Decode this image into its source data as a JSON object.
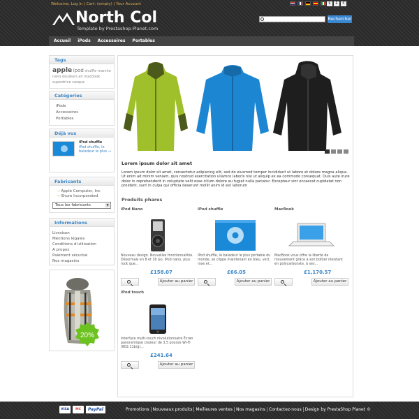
{
  "header": {
    "toplinks": {
      "welcome": "Welcome, ",
      "login": "Log in",
      "sep1": " | ",
      "cart": "Cart: (empty)",
      "sep2": " | ",
      "account": "Your Account"
    },
    "currencies": [
      "$",
      "£",
      "€"
    ],
    "logo_title": "North Col",
    "logo_sub": "Template by Prestashop-Planet.com",
    "search_button": "Rechercher"
  },
  "nav": [
    "Accueil",
    "iPods",
    "Accessoires",
    "Portables"
  ],
  "sidebar": {
    "tags_title": "Tags",
    "tags": {
      "big": "apple",
      "mid": "ipod",
      "rest": "shuffle  marche  nano  douleurs  air  macbook  superdrive  casque"
    },
    "categories_title": "Catégories",
    "categories": [
      "iPods",
      "Accessoires",
      "Portables"
    ],
    "viewed_title": "Déjà vus",
    "viewed_name": "iPod shuffle",
    "viewed_desc": "iPod shuffle, le baladeur le plus →",
    "manufacturers_title": "Fabricants",
    "manufacturers": [
      "Apple Computer, Inc",
      "Shure Incorporated"
    ],
    "manufacturers_select": "Tous les fabricants",
    "info_title": "Informations",
    "info": [
      "Livraison",
      "Mentions légales",
      "Conditions d'utilisation",
      "A propos",
      "Paiement sécurisé",
      "Nos magasins"
    ],
    "promo_badge": "20%"
  },
  "main": {
    "heading": "Lorem ipsum dolor sit amet",
    "text": "Lorem ipsum dolor sit amet, consectetur adipiscing elit, sed do eiusmod tempor incididunt ut labore et dolore magna aliqua. Ut enim ad minim veniam, quis nostrud exercitation ullamco laboris nisi ut aliquip ex ea commodo consequat. Duis aute irure dolor in reprehenderit in voluptate velit esse cillum dolore eu fugiat nulla pariatur. Excepteur sint occaecat cupidatat non proident, sunt in culpa qui officia deserunt mollit anim id est laborum",
    "featured_title": "Produits phares",
    "add_label": "Ajouter au panier",
    "products": [
      {
        "name": "iPod Nano",
        "desc": "Nouveau design. Nouvelles fonctionnalités. Désormais en 8 et 16 Go. iPod nano, plus rock que...",
        "price": "£158.07"
      },
      {
        "name": "iPod shuffle",
        "desc": "iPod shuffle, le baladeur le plus portable du monde, se clippe maintenant en bleu, vert, rose et...",
        "price": "£66.05"
      },
      {
        "name": "MacBook",
        "desc": "MacBook vous offre la liberté de mouvement grâce à son boîtier résistant en polycarbonate, à ses...",
        "price": "£1,170.57"
      },
      {
        "name": "iPod touch",
        "desc": "Interface multi-touch révolutionnaire Écran panoramique couleur de 3,5 pouces Wi-Fi (802.11b/g)...",
        "price": "£241.64"
      }
    ]
  },
  "footer": {
    "payments": [
      "VISA",
      "MC",
      "PayPal"
    ],
    "links": [
      "Promotions",
      "Nouveaux produits",
      "Meilleures ventes",
      "Nos magasins",
      "Contactez-nous",
      "Design by PrestaShop Planet ©"
    ]
  }
}
